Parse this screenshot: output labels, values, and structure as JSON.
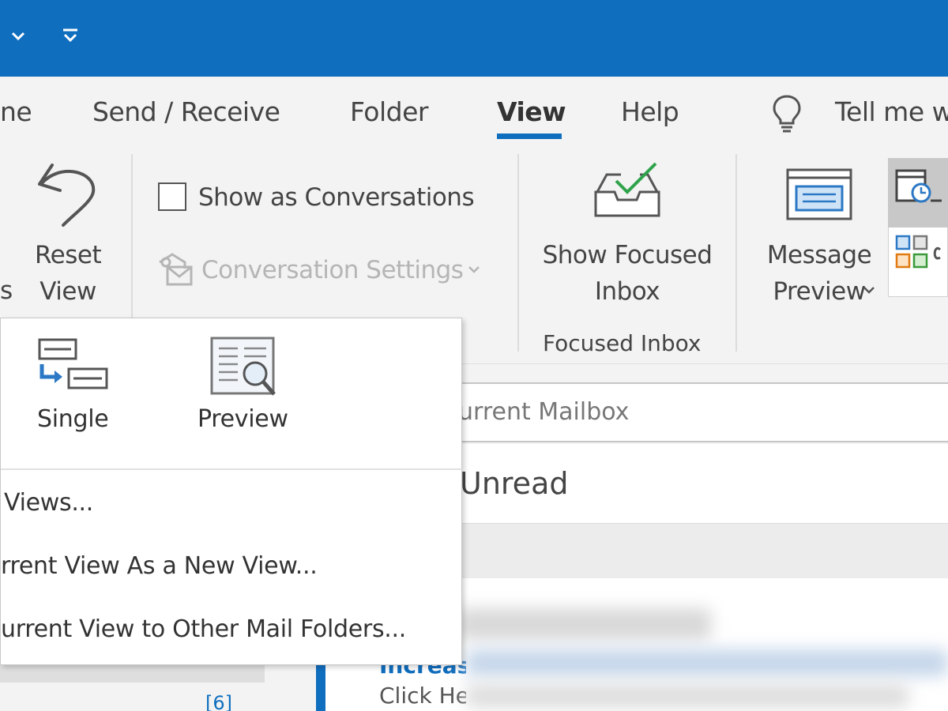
{
  "titlebar": {
    "color": "#106ebe",
    "customize_icon": "chevron-down-icon",
    "qat_icon": "customize-quick-access-icon"
  },
  "ribbon_tabs": [
    {
      "label": "ne",
      "active": false
    },
    {
      "label": "Send / Receive",
      "active": false
    },
    {
      "label": "Folder",
      "active": false
    },
    {
      "label": "View",
      "active": true
    },
    {
      "label": "Help",
      "active": false
    }
  ],
  "tell_me": {
    "label": "Tell me w",
    "icon": "lightbulb-icon"
  },
  "ribbon": {
    "partial_left_label": "s",
    "reset_view": {
      "line1": "Reset",
      "line2": "View",
      "icon": "undo-arrow-icon"
    },
    "show_as_conversations": {
      "label": "Show as Conversations",
      "checked": false
    },
    "conversation_settings": {
      "label": "Conversation Settings",
      "enabled": false
    },
    "show_focused_inbox": {
      "line1": "Show Focused",
      "line2": "Inbox",
      "icon": "focused-inbox-icon"
    },
    "focused_inbox_group": "Focused Inbox",
    "message_preview": {
      "line1": "Message",
      "line2": "Preview",
      "icon": "message-preview-icon"
    }
  },
  "dropdown": {
    "views": [
      {
        "label": "Single",
        "icon": "single-view-icon"
      },
      {
        "label": "Preview",
        "icon": "preview-view-icon"
      }
    ],
    "menu_items": [
      "Views...",
      "rrent View As a New View...",
      "urrent View to Other Mail Folders..."
    ]
  },
  "mail_list": {
    "search_placeholder": "urrent Mailbox",
    "filter_unread": "Unread",
    "message_subject": "Increas",
    "message_preview": "Click He"
  },
  "folder_pane": {
    "unread_count": "[6]"
  },
  "colors": {
    "accent": "#106ebe",
    "ribbon_bg": "#f3f3f3"
  }
}
